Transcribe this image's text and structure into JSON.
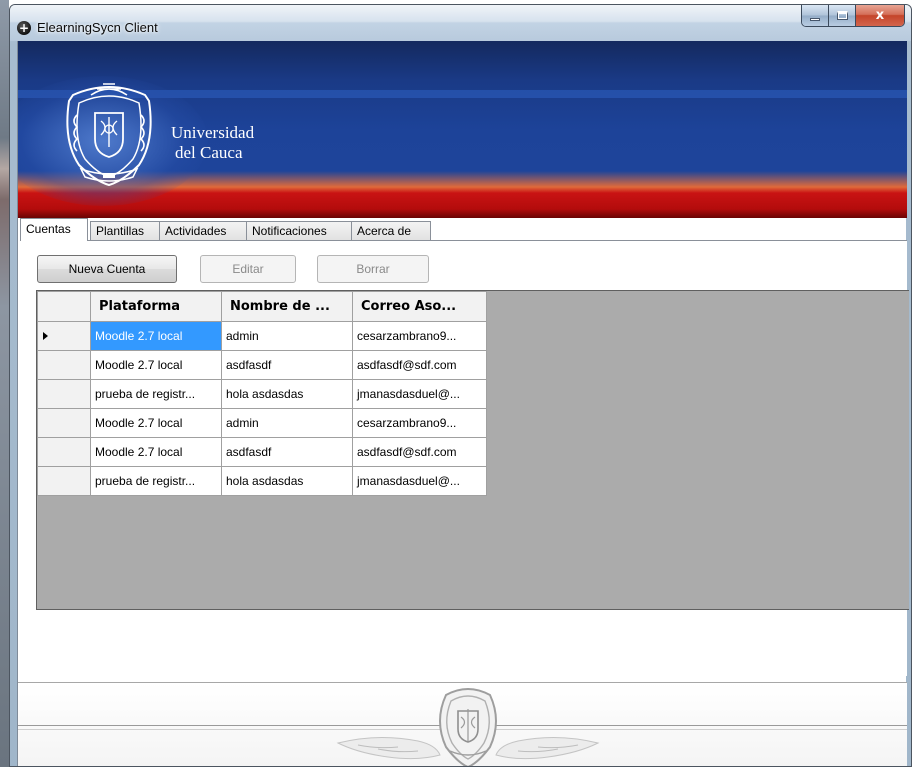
{
  "window": {
    "title": "ElearningSycn Client",
    "app_icon": "+",
    "close_glyph": "x"
  },
  "header": {
    "university_line1": "Universidad",
    "university_line2": "del Cauca",
    "seal_icon": "university-seal"
  },
  "tabs": [
    {
      "label": "Cuentas",
      "active": true
    },
    {
      "label": "Plantillas",
      "active": false
    },
    {
      "label": "Actividades",
      "active": false
    },
    {
      "label": "Notificaciones",
      "active": false
    },
    {
      "label": "Acerca de",
      "active": false
    }
  ],
  "toolbar": {
    "new_account": "Nueva Cuenta",
    "edit": "Editar",
    "delete": "Borrar"
  },
  "grid": {
    "columns": [
      "Plataforma",
      "Nombre de ...",
      "Correo Aso..."
    ],
    "rows": [
      {
        "current": true,
        "platform": "Moodle 2.7 local",
        "name": "admin",
        "email": "cesarzambrano9..."
      },
      {
        "current": false,
        "platform": "Moodle 2.7 local",
        "name": "asdfasdf",
        "email": "asdfasdf@sdf.com"
      },
      {
        "current": false,
        "platform": "prueba de registr...",
        "name": "hola asdasdas",
        "email": "jmanasdasduel@..."
      },
      {
        "current": false,
        "platform": "Moodle 2.7 local",
        "name": "admin",
        "email": "cesarzambrano9..."
      },
      {
        "current": false,
        "platform": "Moodle 2.7 local",
        "name": "asdfasdf",
        "email": "asdfasdf@sdf.com"
      },
      {
        "current": false,
        "platform": "prueba de registr...",
        "name": "hola asdasdas",
        "email": "jmanasdasduel@..."
      }
    ],
    "selection_color": "#3399ff"
  },
  "colors": {
    "banner_blue": "#1e449a",
    "banner_red": "#c91313",
    "grid_background": "#ababab"
  }
}
